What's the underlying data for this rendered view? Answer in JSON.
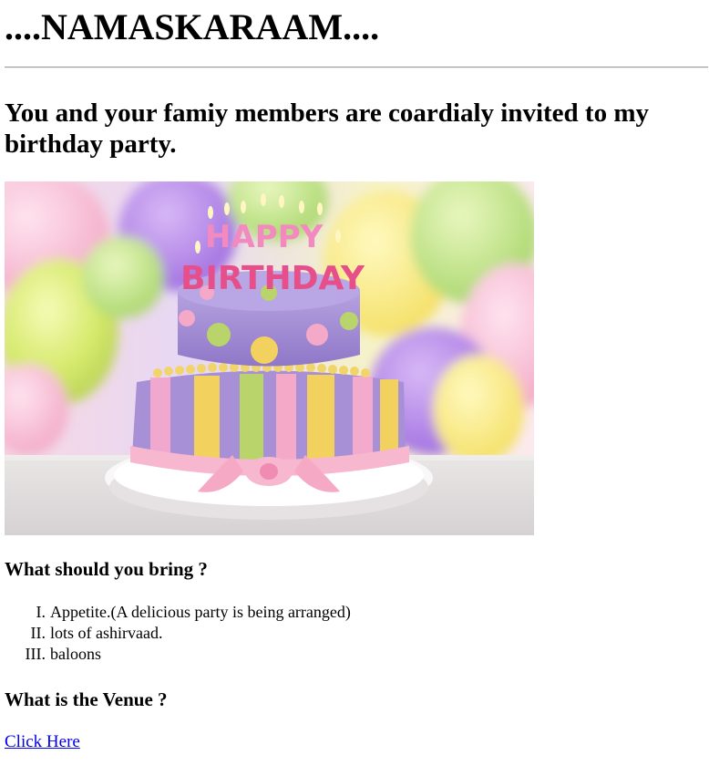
{
  "header": {
    "title": "....NAMASKARAAM....",
    "invitation": "You and your famiy members are coardialy invited to my birthday party."
  },
  "image": {
    "cake_text_top": "HAPPY",
    "cake_text_bottom": "BIRTHDAY",
    "icon": "birthday-cake-photo"
  },
  "bring": {
    "heading": "What should you bring ?",
    "items": [
      {
        "num": "I.",
        "text": "Appetite.(A delicious party is being arranged)"
      },
      {
        "num": "II.",
        "text": "lots of ashirvaad."
      },
      {
        "num": "III.",
        "text": "baloons"
      }
    ]
  },
  "venue": {
    "heading": "What is the Venue ?",
    "link_label": "Click Here"
  },
  "colors": {
    "link": "#0000ee",
    "cake_purple": "#a58fd0",
    "cake_pink": "#f5b8d0",
    "cake_yellow": "#f2d56b",
    "cake_green": "#b9d870"
  }
}
